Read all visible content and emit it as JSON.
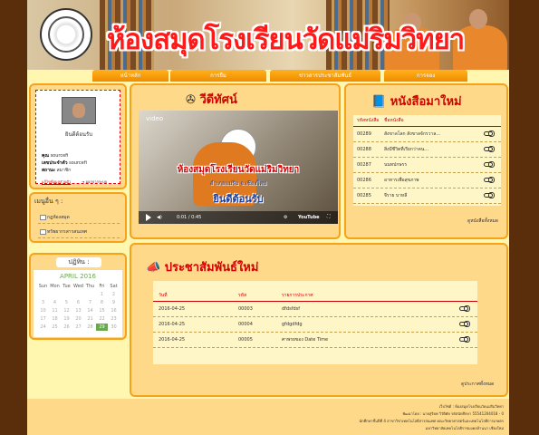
{
  "banner": {
    "title": "ห้องสมุดโรงเรียนวัดแม่ริมวิทยา",
    "logo_icon": "school-seal-icon"
  },
  "nav": [
    {
      "label": "หน้าหลัก"
    },
    {
      "label": "การยืม"
    },
    {
      "label": "ข่าวสารประชาสัมพันธ์"
    },
    {
      "label": "การจอง"
    }
  ],
  "profile": {
    "welcome": "ยินดีต้อนรับ",
    "name_label": "คุณ",
    "name_value": "sourcefi",
    "id_label": "เลขประจำตัว",
    "id_value": "sourcefi",
    "status_label": "สถานะ",
    "status_value": "สมาชิก",
    "logout": "ออกจากระบบ",
    "edit": "แก้ไขข้อมูลส่วนตัว"
  },
  "menu": {
    "title": "เมนูอื่น ๆ :",
    "items": [
      "กฎห้องสมุด",
      "ทรัพยากรสารสนเทศ"
    ]
  },
  "calendar": {
    "title": "ปฏิทิน :",
    "month": "APRIL 2016",
    "days": [
      "Sun",
      "Mon",
      "Tue",
      "Wed",
      "Thu",
      "Fri",
      "Sat"
    ],
    "dates": [
      "",
      "",
      "",
      "",
      "",
      "1",
      "2",
      "3",
      "4",
      "5",
      "6",
      "7",
      "8",
      "9",
      "10",
      "11",
      "12",
      "13",
      "14",
      "15",
      "16",
      "17",
      "18",
      "19",
      "20",
      "21",
      "22",
      "23",
      "24",
      "25",
      "26",
      "27",
      "28",
      "29",
      "30"
    ],
    "today": "29"
  },
  "video": {
    "title": "วีดีทัศน์",
    "caption": "video",
    "line1": "ห้องสมุดโรงเรียนวัดแม่ริมวิทยา",
    "line2": "อำเภอแม่ริม   จ.เชียงใหม่",
    "line3": "ยินดีต้อนรับ",
    "time": "0:01 / 0:45",
    "brand": "YouTube"
  },
  "books": {
    "title": "หนังสือมาใหม่",
    "col_id": "รหัสหนังสือ",
    "col_name": "ชื่อหนังสือ",
    "rows": [
      {
        "id": "00289",
        "name": "สังขาลโลก สังขาลจักรวาล..."
      },
      {
        "id": "00288",
        "name": "สิ่งมีชีวิตที่เรียกว่าคน..."
      },
      {
        "id": "00287",
        "name": "นนทปกษรร"
      },
      {
        "id": "00286",
        "name": "อาหารเพื่อสุขภาพ"
      },
      {
        "id": "00285",
        "name": "จีราย บาหลี"
      }
    ],
    "more": "ดูหนังสือทั้งหมด"
  },
  "news": {
    "title": "ประชาสัมพันธ์ใหม่",
    "col_date": "วันที่",
    "col_id": "รหัส",
    "col_title": "รายการประกาศ",
    "rows": [
      {
        "date": "2016-04-25",
        "id": "00003",
        "title": "dfdsfdsf"
      },
      {
        "date": "2016-04-25",
        "id": "00004",
        "title": "gfdgdfdg"
      },
      {
        "date": "2016-04-25",
        "id": "00005",
        "title": "ศาพรยของ Date Time"
      }
    ],
    "more": "ดูประกาศทั้งหมด"
  },
  "footer": {
    "line1": "เว็บไซต์ : ห้องสมุดโรงเรียนวัดแม่ริมวิทยา",
    "line2": "พัฒนาโดย : นายสุริยพ วิวัติศัย รหัสนักศึกษา 55541204018 - 0",
    "line3": "นักศึกษาชั้นปีที่ 4 สาขาวิชาเทคโนโลยีสารสนเทศ คณะวิทยาศาสตร์และเทคโนโลยีการเกษตร",
    "line4": "มหาวิทยาลัยเทคโนโลยีราชมงคลล้านนา เชียงใหม่"
  }
}
